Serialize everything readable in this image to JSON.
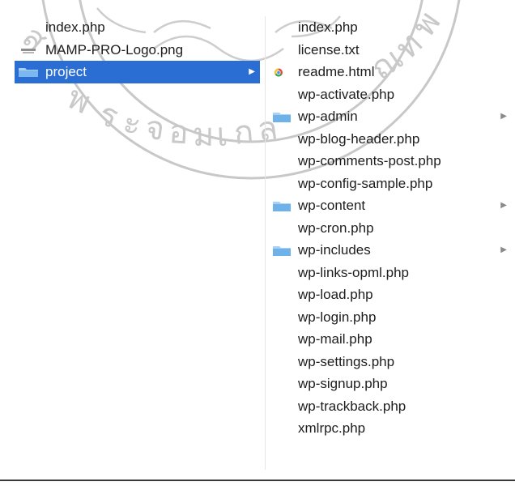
{
  "column1": {
    "items": [
      {
        "name": "index.php",
        "type": "php"
      },
      {
        "name": "MAMP-PRO-Logo.png",
        "type": "png"
      },
      {
        "name": "project",
        "type": "folder",
        "selected": true
      }
    ]
  },
  "column2": {
    "items": [
      {
        "name": "index.php",
        "type": "php"
      },
      {
        "name": "license.txt",
        "type": "txt"
      },
      {
        "name": "readme.html",
        "type": "html"
      },
      {
        "name": "wp-activate.php",
        "type": "php"
      },
      {
        "name": "wp-admin",
        "type": "folder"
      },
      {
        "name": "wp-blog-header.php",
        "type": "php"
      },
      {
        "name": "wp-comments-post.php",
        "type": "php"
      },
      {
        "name": "wp-config-sample.php",
        "type": "php"
      },
      {
        "name": "wp-content",
        "type": "folder"
      },
      {
        "name": "wp-cron.php",
        "type": "php"
      },
      {
        "name": "wp-includes",
        "type": "folder"
      },
      {
        "name": "wp-links-opml.php",
        "type": "php"
      },
      {
        "name": "wp-load.php",
        "type": "php"
      },
      {
        "name": "wp-login.php",
        "type": "php"
      },
      {
        "name": "wp-mail.php",
        "type": "php"
      },
      {
        "name": "wp-settings.php",
        "type": "php"
      },
      {
        "name": "wp-signup.php",
        "type": "php"
      },
      {
        "name": "wp-trackback.php",
        "type": "php"
      },
      {
        "name": "xmlrpc.php",
        "type": "php"
      }
    ]
  },
  "colors": {
    "selection": "#2a6ed4",
    "folder": "#6fb2ea",
    "text": "#1d1d1d"
  }
}
